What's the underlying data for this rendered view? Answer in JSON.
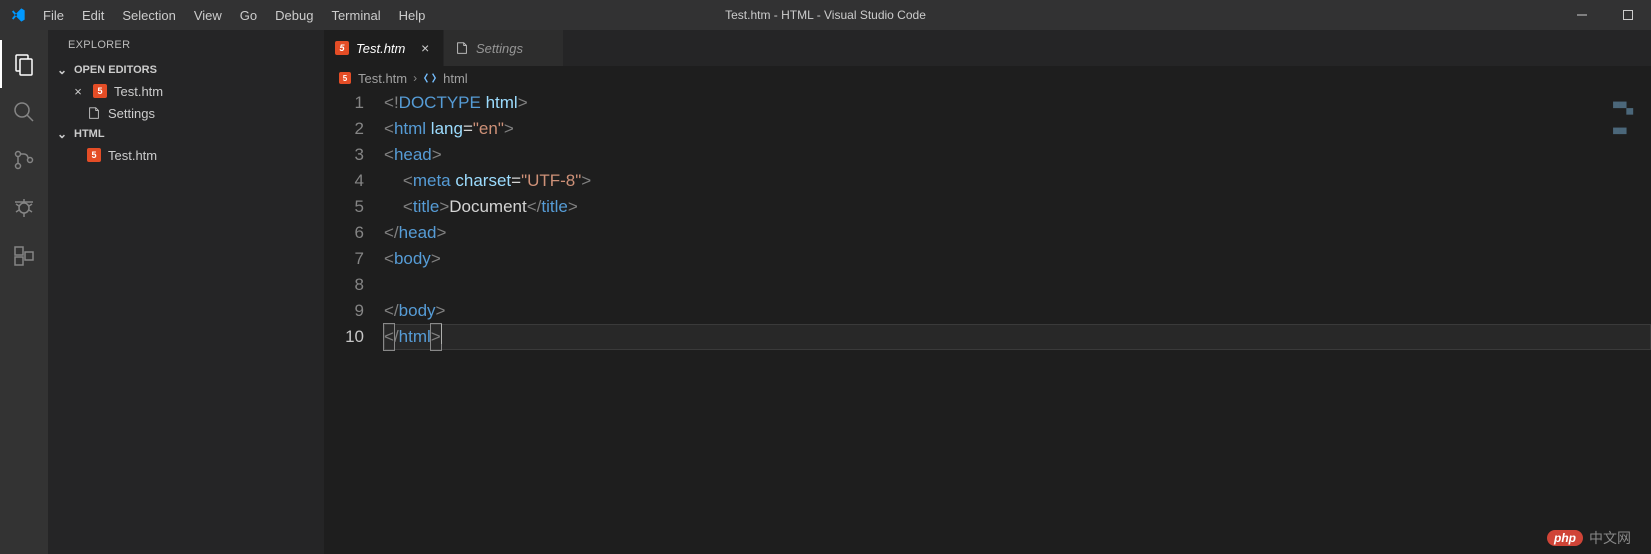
{
  "menu": {
    "file": "File",
    "edit": "Edit",
    "selection": "Selection",
    "view": "View",
    "go": "Go",
    "debug": "Debug",
    "terminal": "Terminal",
    "help": "Help"
  },
  "title": "Test.htm - HTML - Visual Studio Code",
  "sidebar": {
    "explorer": "EXPLORER",
    "open_editors": "OPEN EDITORS",
    "html_section": "HTML",
    "files": {
      "test_htm": "Test.htm",
      "settings": "Settings"
    }
  },
  "tabs": {
    "tab1": "Test.htm",
    "tab2": "Settings"
  },
  "breadcrumb": {
    "file": "Test.htm",
    "symbol": "html"
  },
  "line_numbers": [
    "1",
    "2",
    "3",
    "4",
    "5",
    "6",
    "7",
    "8",
    "9",
    "10"
  ],
  "code": {
    "l1": {
      "lt": "<",
      "bang": "!",
      "doctype": "DOCTYPE",
      "sp": " ",
      "attr": "html",
      "gt": ">"
    },
    "l2": {
      "lt": "<",
      "tag": "html",
      "sp": " ",
      "attr": "lang",
      "eq": "=",
      "str": "\"en\"",
      "gt": ">"
    },
    "l3": {
      "lt": "<",
      "tag": "head",
      "gt": ">"
    },
    "l4": {
      "indent": "    ",
      "lt": "<",
      "tag": "meta",
      "sp": " ",
      "attr": "charset",
      "eq": "=",
      "str": "\"UTF-8\"",
      "gt": ">"
    },
    "l5": {
      "indent": "    ",
      "lt": "<",
      "tag": "title",
      "gt": ">",
      "text": "Document",
      "lt2": "</",
      "tag2": "title",
      "gt2": ">"
    },
    "l6": {
      "lt": "</",
      "tag": "head",
      "gt": ">"
    },
    "l7": {
      "lt": "<",
      "tag": "body",
      "gt": ">"
    },
    "l8": {
      "blank": ""
    },
    "l9": {
      "lt": "</",
      "tag": "body",
      "gt": ">"
    },
    "l10": {
      "lt_open": "<",
      "slash": "/",
      "tag": "html",
      "gt": ">"
    }
  },
  "watermark": {
    "pill": "php",
    "text": "中文网"
  }
}
